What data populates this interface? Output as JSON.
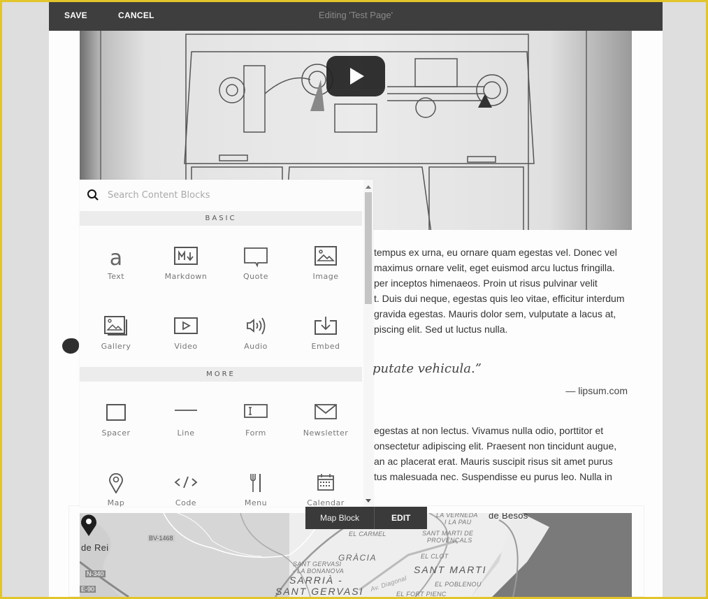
{
  "topbar": {
    "save_label": "SAVE",
    "cancel_label": "CANCEL",
    "title": "Editing 'Test Page'"
  },
  "video": {
    "play_icon": "play-icon"
  },
  "picker": {
    "search_placeholder": "Search Content Blocks",
    "search_value": "",
    "sections": [
      {
        "title": "BASIC",
        "items": [
          {
            "label": "Text",
            "icon": "text-icon"
          },
          {
            "label": "Markdown",
            "icon": "markdown-icon"
          },
          {
            "label": "Quote",
            "icon": "quote-icon"
          },
          {
            "label": "Image",
            "icon": "image-icon"
          },
          {
            "label": "Gallery",
            "icon": "gallery-icon"
          },
          {
            "label": "Video",
            "icon": "video-icon"
          },
          {
            "label": "Audio",
            "icon": "audio-icon"
          },
          {
            "label": "Embed",
            "icon": "embed-icon"
          }
        ]
      },
      {
        "title": "MORE",
        "items": [
          {
            "label": "Spacer",
            "icon": "spacer-icon"
          },
          {
            "label": "Line",
            "icon": "line-icon"
          },
          {
            "label": "Form",
            "icon": "form-icon"
          },
          {
            "label": "Newsletter",
            "icon": "newsletter-icon"
          },
          {
            "label": "Map",
            "icon": "map-pin-icon"
          },
          {
            "label": "Code",
            "icon": "code-icon"
          },
          {
            "label": "Menu",
            "icon": "menu-icon"
          },
          {
            "label": "Calendar",
            "icon": "calendar-icon"
          }
        ]
      }
    ]
  },
  "content": {
    "para1": [
      "tempus ex urna, eu ornare quam egestas vel. Donec vel",
      "maximus ornare velit, eget euismod arcu luctus fringilla.",
      "per inceptos himenaeos. Proin ut risus pulvinar velit",
      "t. Duis dui neque, egestas quis leo vitae, efficitur interdum",
      "gravida egestas. Mauris dolor sem, vulputate a lacus at,",
      "piscing elit. Sed ut luctus nulla."
    ],
    "quote": "putate vehicula.”",
    "quote_source": "— lipsum.com",
    "para2": [
      "egestas at non lectus. Vivamus nulla odio, porttitor et",
      "onsectetur adipiscing elit. Praesent non tincidunt augue,",
      "an ac placerat erat. Mauris suscipit risus sit amet purus",
      "tus malesuada nec. Suspendisse eu purus leo. Nulla in"
    ]
  },
  "map_block": {
    "label": "Map Block",
    "edit_label": "EDIT",
    "places": {
      "de_rei": "de Rei",
      "bv1468": "BV-1468",
      "n340": "N-340",
      "e90": "E-90",
      "el_carmel": "EL CARMEL",
      "gracia": "GRÀCIA",
      "sant_gervasi_bonanova_1": "SANT GERVASI",
      "sant_gervasi_bonanova_2": "- LA BONANOVA",
      "sarria_1": "SARRIÀ -",
      "sarria_2": "SANT GERVASI",
      "diagonal": "Av. Diagonal",
      "la_verneda_1": "LA VERNEDA",
      "la_verneda_2": "I LA PAU",
      "de_besos": "de Besos",
      "sant_marti_provencals_1": "SANT MARTI DE",
      "sant_marti_provencals_2": "PROVENÇALS",
      "el_clot": "EL CLOT",
      "sant_marti": "SANT MARTI",
      "el_poblenou": "EL POBLENOU",
      "el_fort_pienc": "EL FORT PIENC"
    }
  }
}
